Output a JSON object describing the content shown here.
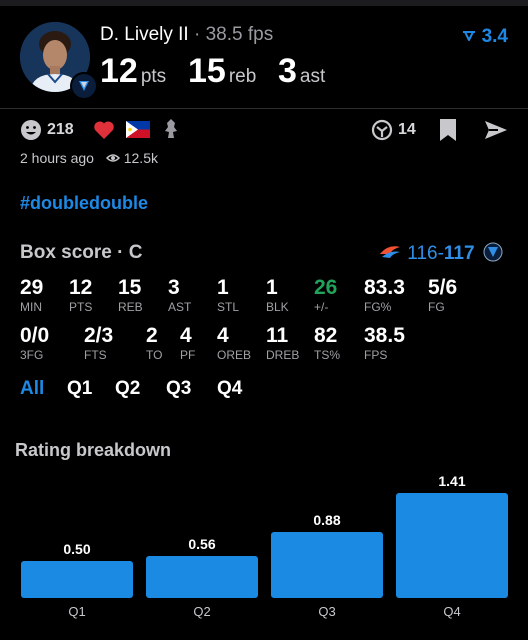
{
  "player": {
    "name": "D. Lively II",
    "separator": "·",
    "fps": "38.5 fps",
    "points": "12",
    "points_unit": "pts",
    "rebounds": "15",
    "rebounds_unit": "reb",
    "assists": "3",
    "assists_unit": "ast",
    "rating": "3.4",
    "rating_icon": "trend-down-icon"
  },
  "social": {
    "likes": "218",
    "comments": "14",
    "time_ago": "2 hours ago",
    "views": "12.5k",
    "hashtag": "#doubledouble"
  },
  "box_score": {
    "title": "Box score · C",
    "score_home": "116",
    "score_dash": "-",
    "score_away": "117",
    "row1": [
      {
        "value": "29",
        "label": "MIN"
      },
      {
        "value": "12",
        "label": "PTS"
      },
      {
        "value": "15",
        "label": "REB"
      },
      {
        "value": "3",
        "label": "AST"
      },
      {
        "value": "1",
        "label": "STL"
      },
      {
        "value": "1",
        "label": "BLK"
      },
      {
        "value": "26",
        "label": "+/-"
      },
      {
        "value": "83.3",
        "label": "FG%"
      },
      {
        "value": "5/6",
        "label": "FG"
      }
    ],
    "row2": [
      {
        "value": "0/0",
        "label": "3FG"
      },
      {
        "value": "2/3",
        "label": "FTS"
      },
      {
        "value": "2",
        "label": "TO"
      },
      {
        "value": "4",
        "label": "PF"
      },
      {
        "value": "4",
        "label": "OREB"
      },
      {
        "value": "11",
        "label": "DREB"
      },
      {
        "value": "82",
        "label": "TS%"
      },
      {
        "value": "38.5",
        "label": "FPS"
      }
    ],
    "tabs": [
      "All",
      "Q1",
      "Q2",
      "Q3",
      "Q4"
    ],
    "active_tab": "All"
  },
  "rating_breakdown": {
    "title": "Rating breakdown"
  },
  "chart_data": {
    "type": "bar",
    "categories": [
      "Q1",
      "Q2",
      "Q3",
      "Q4"
    ],
    "values": [
      0.5,
      0.56,
      0.88,
      1.41
    ],
    "value_labels": [
      "0.50",
      "0.56",
      "0.88",
      "1.41"
    ]
  },
  "colors": {
    "accent": "#1e88e5",
    "positive": "#22a35a",
    "like": "#e0303a",
    "bar": "#1b8ae3"
  }
}
